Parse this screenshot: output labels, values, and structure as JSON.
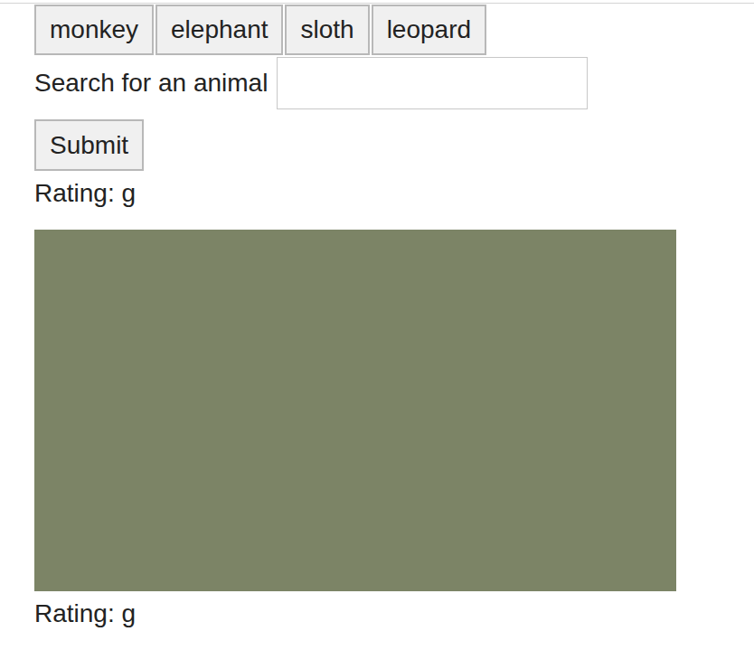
{
  "animal_buttons": [
    "monkey",
    "elephant",
    "sloth",
    "leopard"
  ],
  "search": {
    "label": "Search for an animal",
    "value": ""
  },
  "submit_button": "Submit",
  "results": [
    {
      "rating": "Rating: g",
      "has_image": false
    },
    {
      "rating": "Rating: g",
      "has_image": true
    }
  ]
}
